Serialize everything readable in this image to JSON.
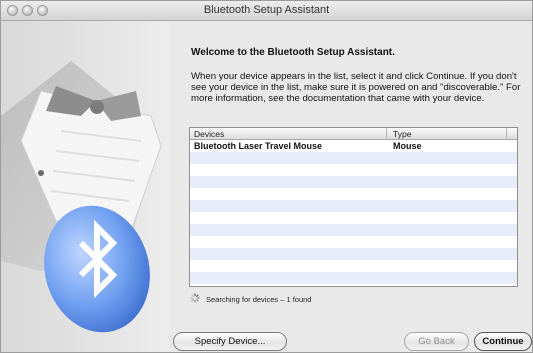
{
  "window": {
    "title": "Bluetooth Setup Assistant"
  },
  "content": {
    "heading": "Welcome to the Bluetooth Setup Assistant.",
    "description": "When your device appears in the list, select it and click Continue. If you don't see your device in the list, make sure it is powered on and \"discoverable.\" For more information, see the documentation that came with your device."
  },
  "table": {
    "columns": [
      "Devices",
      "Type"
    ],
    "rows": [
      {
        "device": "Bluetooth Laser Travel Mouse",
        "type": "Mouse"
      }
    ]
  },
  "status": {
    "text": "Searching for devices – 1 found"
  },
  "buttons": {
    "specify": "Specify Device...",
    "back": "Go Back",
    "continue": "Continue"
  },
  "icons": {
    "bluetooth_color": "#5b8fe6"
  }
}
